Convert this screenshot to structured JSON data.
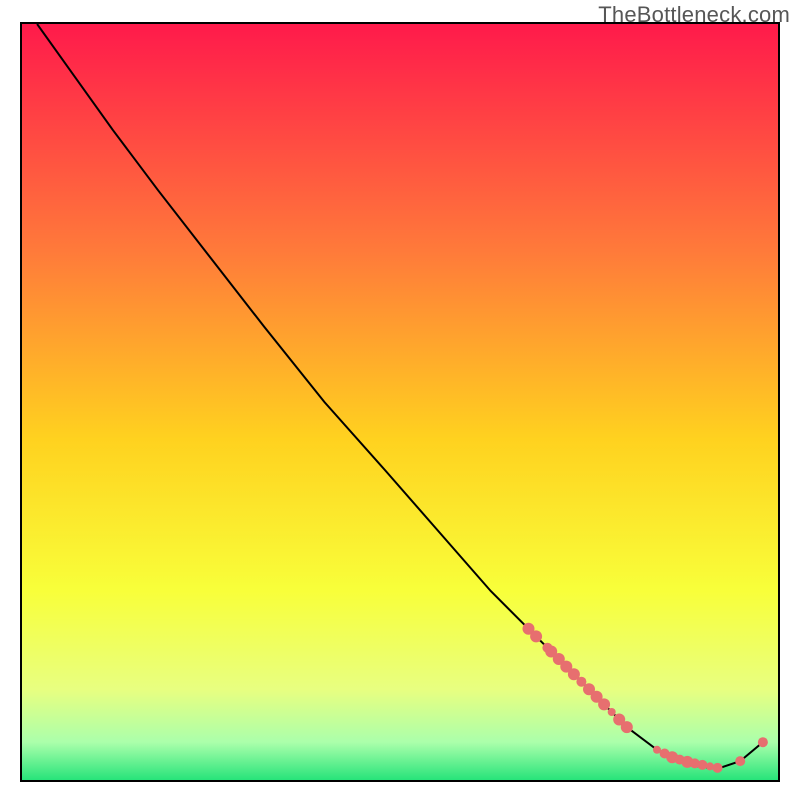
{
  "watermark": "TheBottleneck.com",
  "chart_data": {
    "type": "line",
    "title": "",
    "xlabel": "",
    "ylabel": "",
    "xlim": [
      0,
      100
    ],
    "ylim": [
      0,
      100
    ],
    "background_gradient": {
      "top": "#ff1a4b",
      "upper_mid": "#ff7a3a",
      "mid": "#ffd21f",
      "lower_mid": "#f8ff3a",
      "lower": "#e8ff80",
      "band": "#abffab",
      "bottom": "#27e47a"
    },
    "series": [
      {
        "name": "bottleneck-curve",
        "x": [
          2,
          7,
          12,
          18,
          25,
          32,
          40,
          48,
          55,
          62,
          68,
          73,
          77,
          80,
          84,
          88,
          92,
          95,
          98
        ],
        "y": [
          100,
          93,
          86,
          78,
          69,
          60,
          50,
          41,
          33,
          25,
          19,
          14,
          10,
          7,
          4,
          2,
          1.5,
          2.5,
          5
        ]
      }
    ],
    "markers": {
      "name": "highlighted-points",
      "color": "#e76f6f",
      "x": [
        67,
        68,
        69.5,
        70,
        71,
        72,
        73,
        74,
        75,
        76,
        77,
        78,
        79,
        80,
        84,
        85,
        86,
        87,
        88,
        89,
        90,
        91,
        92,
        95,
        98
      ],
      "y": [
        20,
        19,
        17.5,
        17,
        16,
        15,
        14,
        13,
        12,
        11,
        10,
        9,
        8,
        7,
        4,
        3.5,
        3,
        2.7,
        2.4,
        2.2,
        2,
        1.8,
        1.6,
        2.5,
        5
      ],
      "radius": [
        6,
        6,
        5,
        6,
        6,
        6,
        6,
        5,
        6,
        6,
        6,
        4,
        6,
        6,
        4,
        5,
        6,
        5,
        6,
        5,
        5,
        4,
        5,
        5,
        5
      ]
    }
  }
}
